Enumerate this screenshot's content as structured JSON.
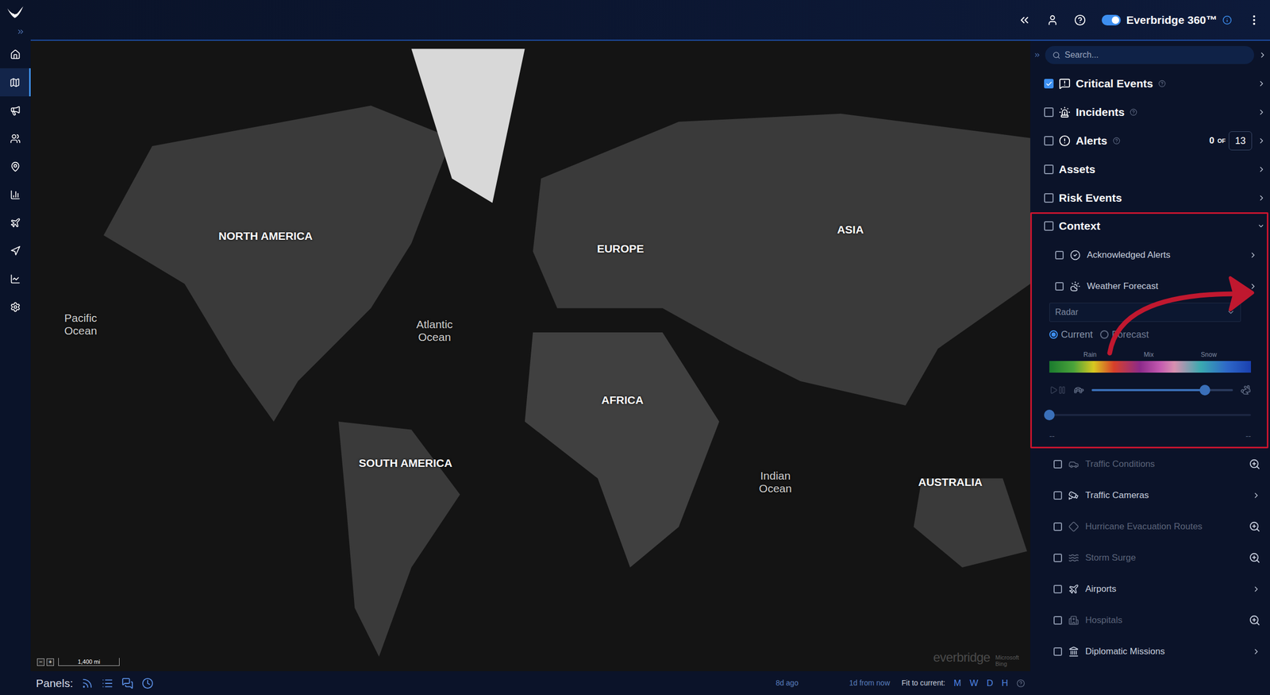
{
  "header": {
    "brand": "Everbridge 360™",
    "toggle_on": true
  },
  "nav": {
    "items": [
      {
        "selected": false
      },
      {
        "selected": true
      },
      {
        "selected": false
      },
      {
        "selected": false
      },
      {
        "selected": false
      },
      {
        "selected": false
      },
      {
        "selected": false
      },
      {
        "selected": false
      },
      {
        "selected": false
      },
      {
        "selected": false
      }
    ]
  },
  "map": {
    "labels": [
      {
        "text": "NORTH AMERICA",
        "kind": "continent"
      },
      {
        "text": "EUROPE",
        "kind": "continent"
      },
      {
        "text": "ASIA",
        "kind": "continent"
      },
      {
        "text": "AFRICA",
        "kind": "continent"
      },
      {
        "text": "SOUTH AMERICA",
        "kind": "continent"
      },
      {
        "text": "AUSTRALIA",
        "kind": "continent"
      },
      {
        "text": "Pacific Ocean",
        "kind": "ocean"
      },
      {
        "text": "Atlantic Ocean",
        "kind": "ocean"
      },
      {
        "text": "Indian Ocean",
        "kind": "ocean"
      }
    ],
    "zoom_buttons": [
      "−",
      "+"
    ],
    "scale": "1,400 mi",
    "watermark": "everbridge",
    "provider": "Microsoft Bing"
  },
  "layers_panel": {
    "search": {
      "placeholder": "Search..."
    },
    "layers": [
      {
        "label": "Critical Events",
        "checked": true,
        "help": true
      },
      {
        "label": "Incidents",
        "checked": false,
        "help": true
      },
      {
        "label": "Alerts",
        "checked": false,
        "help": true,
        "count": "0",
        "of": "OF",
        "total": "13"
      },
      {
        "label": "Assets",
        "checked": false,
        "help": false
      },
      {
        "label": "Risk Events",
        "checked": false,
        "help": false
      }
    ],
    "context": {
      "label": "Context",
      "checked": false,
      "expanded": true,
      "highlighted": true,
      "items": [
        {
          "label": "Acknowledged Alerts",
          "checked": false,
          "disabled": false,
          "action": "expand",
          "expanded": false
        },
        {
          "label": "Weather Forecast",
          "checked": false,
          "disabled": false,
          "action": "expand",
          "expanded": true
        },
        {
          "label": "Traffic Conditions",
          "checked": false,
          "disabled": true,
          "action": "zoom",
          "expanded": false
        },
        {
          "label": "Traffic Cameras",
          "checked": false,
          "disabled": false,
          "action": "expand",
          "expanded": false
        },
        {
          "label": "Hurricane Evacuation Routes",
          "checked": false,
          "disabled": true,
          "action": "zoom",
          "expanded": false
        },
        {
          "label": "Storm Surge",
          "checked": false,
          "disabled": true,
          "action": "zoom",
          "expanded": false
        },
        {
          "label": "Airports",
          "checked": false,
          "disabled": false,
          "action": "expand",
          "expanded": false
        },
        {
          "label": "Hospitals",
          "checked": false,
          "disabled": true,
          "action": "zoom",
          "expanded": false
        },
        {
          "label": "Diplomatic Missions",
          "checked": false,
          "disabled": false,
          "action": "expand",
          "expanded": false
        }
      ],
      "weather": {
        "layer": "Radar",
        "modes": [
          {
            "label": "Current",
            "selected": true
          },
          {
            "label": "Forecast",
            "selected": false
          }
        ],
        "legend": [
          "Rain",
          "Mix",
          "Snow"
        ],
        "speed": 0.8,
        "timeline": 0,
        "start": "--",
        "end": "--"
      }
    }
  },
  "bottom_bar": {
    "panels_label": "Panels:",
    "range_start": "8d ago",
    "range_end": "1d from now",
    "fit_label": "Fit to current:",
    "fit_options": [
      "M",
      "W",
      "D",
      "H"
    ]
  }
}
